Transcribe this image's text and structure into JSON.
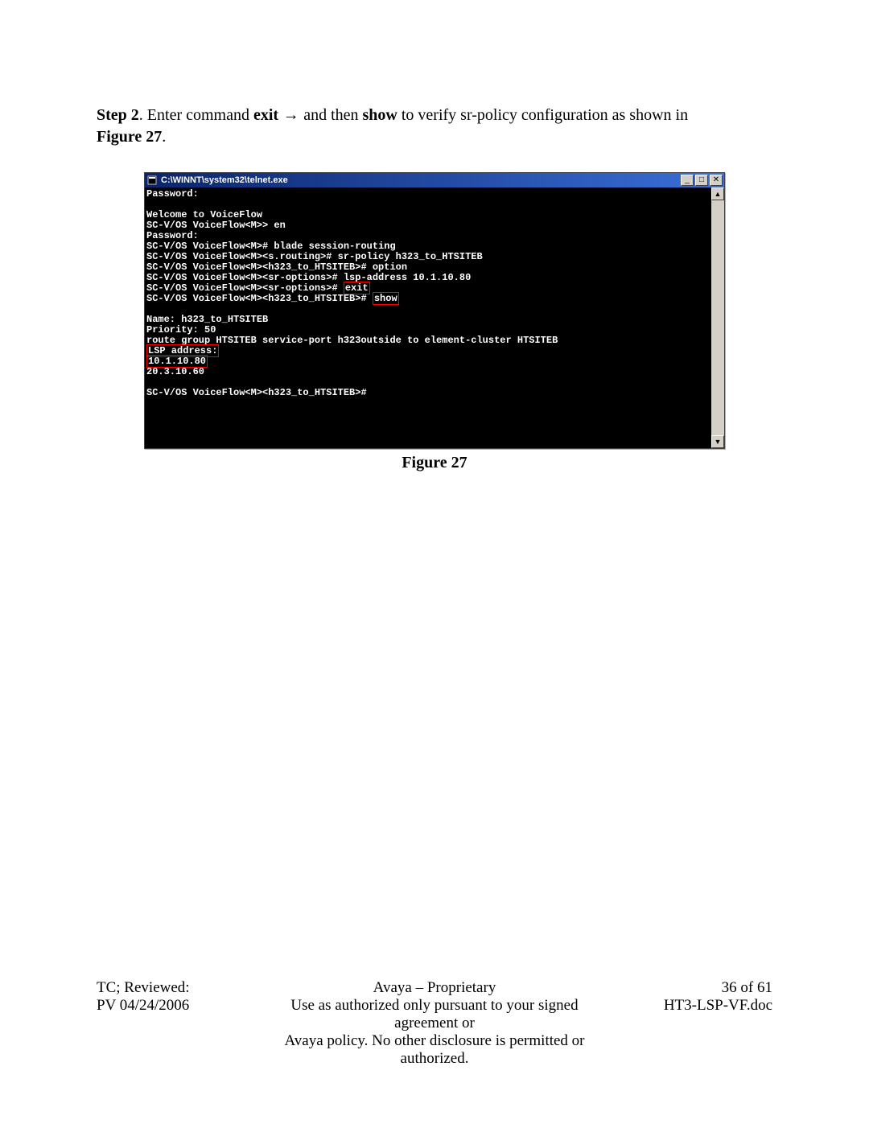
{
  "instruction": {
    "step_label": "Step 2",
    "text_a": ". Enter command ",
    "cmd1": "exit",
    "arrow": " → ",
    "text_b": "and then ",
    "cmd2": "show",
    "text_c": " to verify sr-policy configuration as shown in ",
    "figure_ref": "Figure 27",
    "period": "."
  },
  "window": {
    "title": "C:\\WINNT\\system32\\telnet.exe",
    "min_glyph": "_",
    "max_glyph": "□",
    "close_glyph": "✕",
    "scroll_up": "▲",
    "scroll_down": "▼"
  },
  "terminal": {
    "l1": "Password:",
    "l2": "",
    "l3": "Welcome to VoiceFlow",
    "l4": "SC-V/OS VoiceFlow<M>> en",
    "l5": "Password:",
    "l6": "SC-V/OS VoiceFlow<M># blade session-routing",
    "l7": "SC-V/OS VoiceFlow<M><s.routing># sr-policy h323_to_HTSITEB",
    "l8": "SC-V/OS VoiceFlow<M><h323_to_HTSITEB># option",
    "l9": "SC-V/OS VoiceFlow<M><sr-options># lsp-address 10.1.10.80",
    "l10a": "SC-V/OS VoiceFlow<M><sr-options># ",
    "l10b": "exit",
    "l11a": "SC-V/OS VoiceFlow<M><h323_to_HTSITEB># ",
    "l11b": "show",
    "l12": "",
    "l13": "Name: h323_to_HTSITEB",
    "l14": "Priority: 50",
    "l15": "route group HTSITEB service-port h323outside to element-cluster HTSITEB",
    "l16": "LSP address:",
    "l17": "10.1.10.80",
    "l18": "20.3.10.60",
    "l19": "",
    "l20": "SC-V/OS VoiceFlow<M><h323_to_HTSITEB>#"
  },
  "caption": "Figure 27",
  "footer": {
    "left1": "TC; Reviewed:",
    "left2": "PV 04/24/2006",
    "center1": "Avaya – Proprietary",
    "center2": "Use as authorized only pursuant to your signed agreement or",
    "center3": "Avaya policy. No other disclosure is permitted or authorized.",
    "right1": "36 of 61",
    "right2": "HT3-LSP-VF.doc"
  }
}
